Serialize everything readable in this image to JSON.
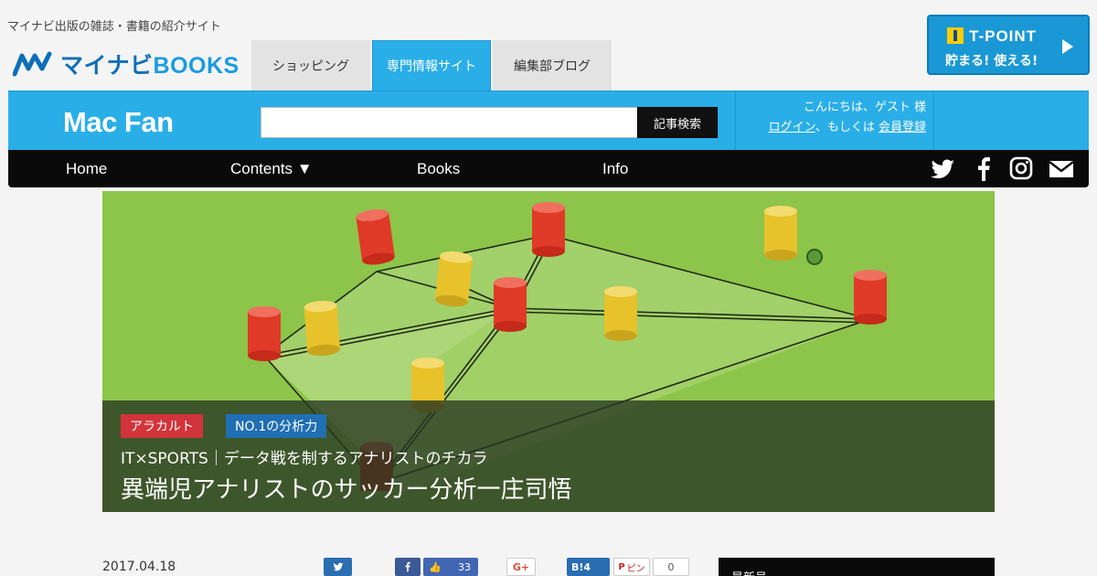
{
  "header": {
    "tagline": "マイナビ出版の雑誌・書籍の紹介サイト",
    "brand_main": "マイナビ",
    "brand_books": "BOOKS",
    "tabs": [
      {
        "label": "ショッピング"
      },
      {
        "label": "専門情報サイト",
        "active": true
      },
      {
        "label": "編集部ブログ"
      }
    ],
    "tpoint": {
      "title": "T-POINT",
      "sub": "貯まる! 使える!"
    }
  },
  "site": {
    "logo": "Mac Fan",
    "search": {
      "value": "",
      "button": "記事検索"
    },
    "greeting": "こんにちは、ゲスト 様",
    "login": "ログイン",
    "or_text": "、もしくは ",
    "register": "会員登録"
  },
  "nav": {
    "items": [
      {
        "label": "Home"
      },
      {
        "label": "Contents ▼"
      },
      {
        "label": "Books"
      },
      {
        "label": "Info"
      }
    ],
    "social_icons": [
      "twitter-icon",
      "facebook-icon",
      "instagram-icon",
      "mail-icon"
    ]
  },
  "hero": {
    "tags": [
      "アラカルト",
      "NO.1の分析力"
    ],
    "subtitle": "IT×SPORTS｜データ戦を制するアナリストのチカラ",
    "title": "異端児アナリストのサッカー分析一庄司悟"
  },
  "article": {
    "date": "2017.04.18",
    "share": {
      "facebook_like_count": "33",
      "hatena_label": "B!",
      "hatena_count": "4",
      "google_plus": "G+",
      "pin_label": "ピン",
      "pin_count": "0"
    }
  },
  "sidebar": {
    "latest_heading": "最新号"
  },
  "colors": {
    "brand_blue": "#2aaee8",
    "nav_black": "#0a0a0a",
    "field_green": "#8dc44a",
    "tag_red": "#d1343a",
    "tag_blue": "#1f6fb2"
  }
}
